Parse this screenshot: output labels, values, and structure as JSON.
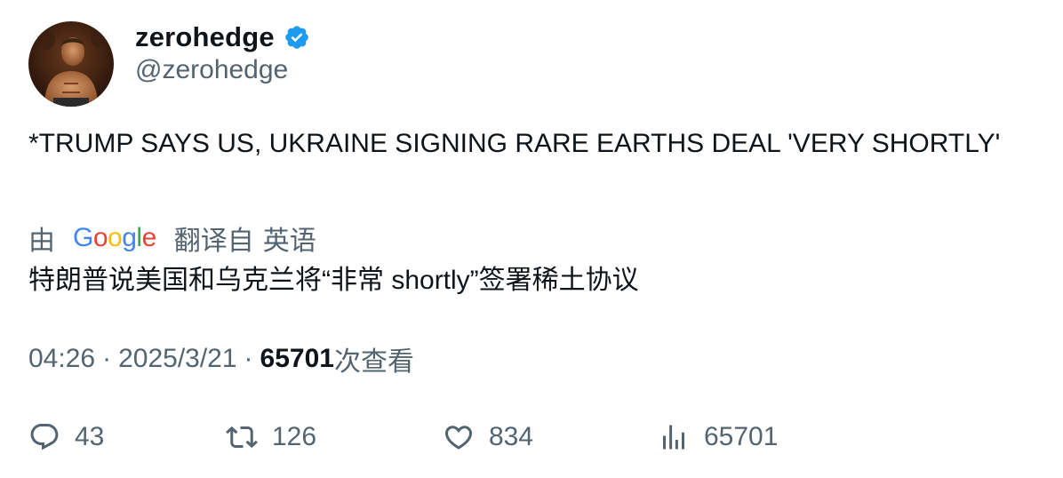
{
  "user": {
    "display_name": "zerohedge",
    "handle": "@zerohedge",
    "verified_color": "#1d9bf0"
  },
  "tweet": {
    "text": "*TRUMP SAYS US, UKRAINE SIGNING RARE EARTHS DEAL 'VERY SHORTLY'"
  },
  "translation": {
    "prefix": "由",
    "provider": "Google",
    "suffix": "翻译自",
    "language": "英语",
    "text": "特朗普说美国和乌克兰将“非常 shortly”签署稀土协议"
  },
  "meta": {
    "time": "04:26",
    "separator": "·",
    "date": "2025/3/21",
    "views_count": "65701",
    "views_label": "次查看"
  },
  "actions": {
    "replies": "43",
    "reposts": "126",
    "likes": "834",
    "views": "65701"
  },
  "icons": {
    "reply": "reply-icon",
    "repost": "repost-icon",
    "like": "heart-icon",
    "views": "analytics-icon",
    "verified": "verified-badge-icon"
  }
}
